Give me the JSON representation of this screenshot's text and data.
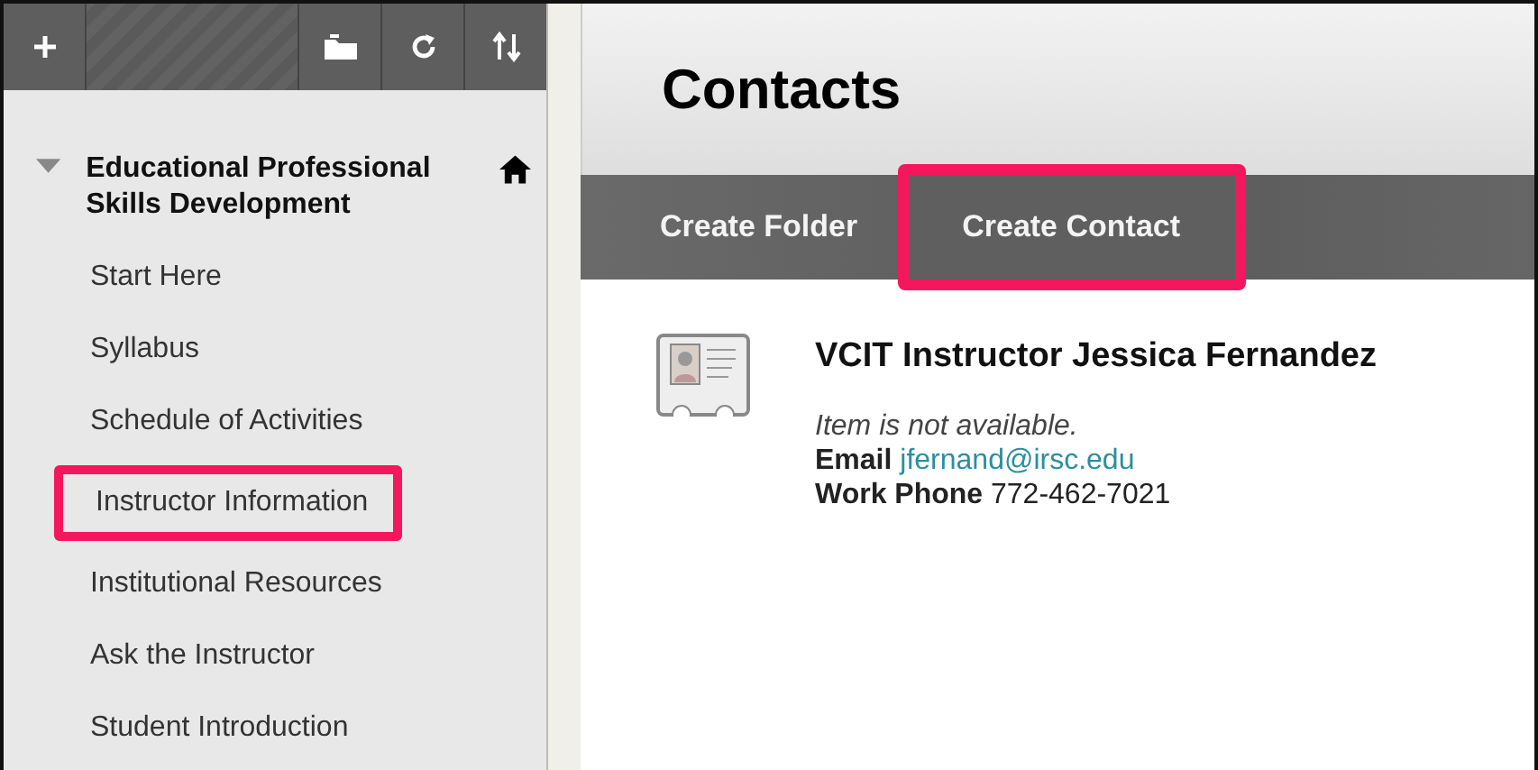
{
  "toolbar": {
    "buttons": [
      {
        "kind": "add"
      },
      {
        "kind": "folder"
      },
      {
        "kind": "refresh"
      },
      {
        "kind": "sort"
      }
    ]
  },
  "course": {
    "title": "Educational Professional Skills Development",
    "expanded": true
  },
  "menu": [
    {
      "label": "Start Here",
      "highlighted": false
    },
    {
      "label": "Syllabus",
      "highlighted": false
    },
    {
      "label": "Schedule of Activities",
      "highlighted": false
    },
    {
      "label": "Instructor Information",
      "highlighted": true
    },
    {
      "label": "Institutional Resources",
      "highlighted": false
    },
    {
      "label": "Ask the Instructor",
      "highlighted": false
    },
    {
      "label": "Student Introduction",
      "highlighted": false
    }
  ],
  "page": {
    "title": "Contacts"
  },
  "actions": [
    {
      "label": "Create Folder",
      "highlighted": false
    },
    {
      "label": "Create Contact",
      "highlighted": true
    }
  ],
  "contact": {
    "name": "VCIT Instructor Jessica Fernandez",
    "status": "Item is not available.",
    "email_label": "Email",
    "email": "jfernand@irsc.edu",
    "phone_label": "Work Phone",
    "phone": "772-462-7021"
  }
}
